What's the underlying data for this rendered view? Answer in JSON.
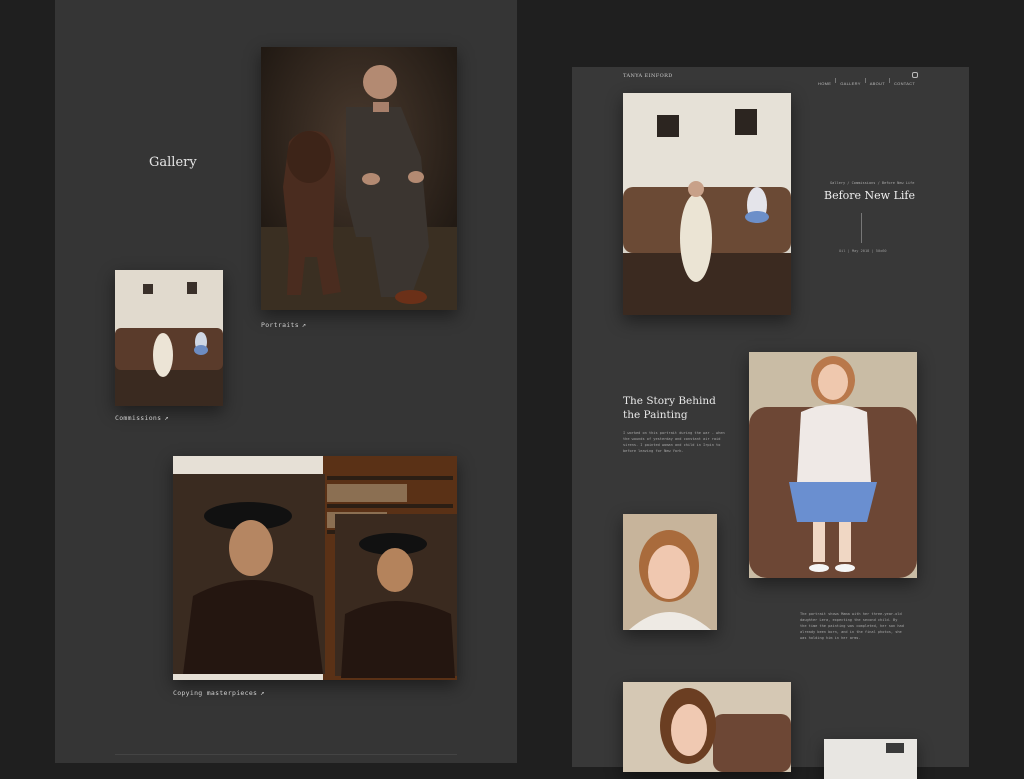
{
  "gallery": {
    "title": "Gallery",
    "captions": {
      "portraits": "Portraits",
      "commissions": "Commissions",
      "masterpieces": "Copying masterpieces"
    },
    "arrow": "↗"
  },
  "site": {
    "brand": "TANYA EINFORD",
    "nav": [
      "HOME",
      "GALLERY",
      "ABOUT",
      "CONTACT"
    ]
  },
  "article": {
    "breadcrumb": "Gallery / Commissions / Before New Life",
    "title": "Before New Life",
    "meta": "Oil | May 2018 | 50x60",
    "story_heading": "The Story Behind the Painting",
    "story_text": "I worked on this portrait during the war - when the wounds of yesterday and constant air raid sirens. I painted woman and child in Irpin to before leaving for New York.",
    "story_text2": "The portrait shows Mama with her three-year-old daughter Lera, expecting the second child. By the time the painting was completed, her son had already been born, and in the final photos, she was holding him in her arms."
  },
  "colors": {
    "page_bg": "#1f1f1f",
    "left_panel": "#353535",
    "right_panel": "#383838"
  }
}
